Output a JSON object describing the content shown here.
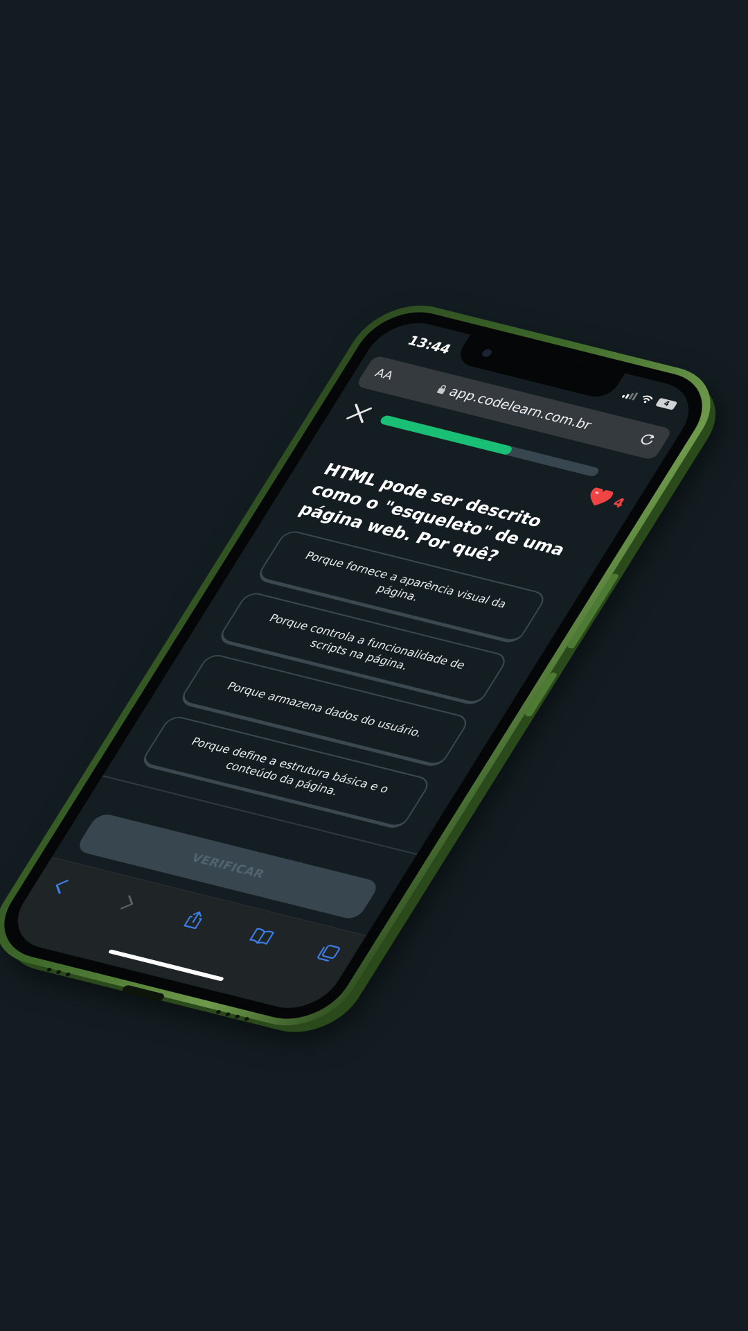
{
  "status_bar": {
    "time": "13:44",
    "battery_level": "4"
  },
  "browser": {
    "text_size_label": "AA",
    "url": "app.codelearn.com.br"
  },
  "lesson": {
    "progress": 0.6,
    "lives": "4",
    "question": "HTML pode ser descrito como o \"esqueleto\" de uma página web. Por quê?",
    "options": [
      "Porque fornece a aparência visual da página.",
      "Porque controla a funcionalidade de scripts na página.",
      "Porque armazena dados do usuário.",
      "Porque define a estrutura básica e o conteúdo da página."
    ],
    "verify_label": "VERIFICAR"
  },
  "toolbar": {
    "icons": [
      "back-icon",
      "forward-icon",
      "share-icon",
      "bookmarks-icon",
      "tabs-icon"
    ]
  },
  "colors": {
    "background": "#131d21",
    "accent_green": "#18bf74",
    "heart_red": "#ef4444",
    "safari_blue": "#3d7eea",
    "phone_green": "#3f6a2b"
  }
}
